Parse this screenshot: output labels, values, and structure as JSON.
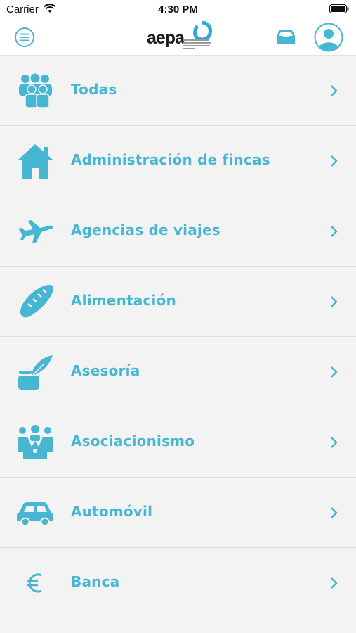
{
  "status_bar": {
    "carrier": "Carrier",
    "time": "4:30 PM"
  },
  "navbar": {
    "logo_text": "aepa",
    "menu_icon": "hamburger-menu-icon",
    "inbox_icon": "inbox-tray-icon",
    "profile_icon": "user-avatar-icon"
  },
  "colors": {
    "accent": "#47b6d3",
    "background": "#f3f3f3",
    "divider": "#dedede"
  },
  "categories": [
    {
      "label": "Todas",
      "icon": "people-group-icon"
    },
    {
      "label": "Administración de fincas",
      "icon": "house-icon"
    },
    {
      "label": "Agencias de viajes",
      "icon": "airplane-icon"
    },
    {
      "label": "Alimentación",
      "icon": "bread-icon"
    },
    {
      "label": "Asesoría",
      "icon": "quill-inkwell-icon"
    },
    {
      "label": "Asociacionismo",
      "icon": "association-people-icon"
    },
    {
      "label": "Automóvil",
      "icon": "car-icon"
    },
    {
      "label": "Banca",
      "icon": "euro-icon"
    }
  ]
}
